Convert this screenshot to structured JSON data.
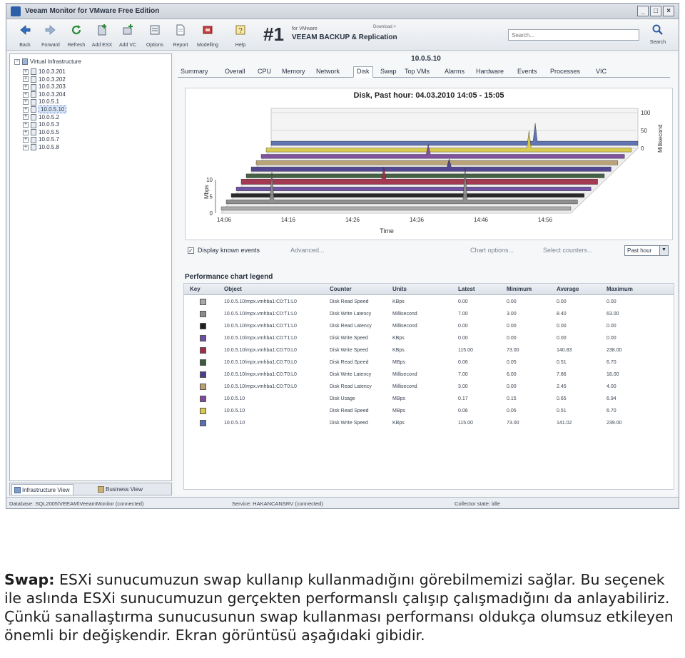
{
  "window": {
    "title": "Veeam Monitor for VMware Free Edition",
    "controls": [
      "_",
      "□",
      "×"
    ]
  },
  "toolbar": {
    "buttons": [
      {
        "label": "Back",
        "icon": "back-arrow-icon"
      },
      {
        "label": "Forward",
        "icon": "forward-arrow-icon"
      },
      {
        "label": "Refresh",
        "icon": "refresh-icon"
      },
      {
        "label": "Add ESX",
        "icon": "add-server-icon"
      },
      {
        "label": "Add VC",
        "icon": "add-vcenter-icon"
      },
      {
        "label": "Options",
        "icon": "options-icon"
      },
      {
        "label": "Report",
        "icon": "report-icon"
      },
      {
        "label": "Modelling",
        "icon": "modelling-icon"
      },
      {
        "label": "Help",
        "icon": "help-icon"
      }
    ],
    "banner": {
      "number": "#1",
      "small": "for VMware",
      "brand": "VEEAM BACKUP & Replication",
      "download": "Download >"
    },
    "search_placeholder": "Search...",
    "search_button_label": "Search"
  },
  "sidebar": {
    "root": "Virtual Infrastructure",
    "hosts": [
      "10.0.3.201",
      "10.0.3.202",
      "10.0.3.203",
      "10.0.3.204",
      "10.0.5.1",
      "10.0.5.10",
      "10.0.5.2",
      "10.0.5.3",
      "10.0.5.5",
      "10.0.5.7",
      "10.0.5.8"
    ],
    "selected": "10.0.5.10",
    "tabs": [
      "Infrastructure View",
      "Business View"
    ]
  },
  "main": {
    "host_title": "10.0.5.10",
    "tabs": [
      "Summary",
      "Overall",
      "CPU",
      "Memory",
      "Network",
      "Disk",
      "Swap",
      "Top VMs",
      "Alarms",
      "Hardware",
      "Events",
      "Processes",
      "VIC"
    ],
    "active_tab": "Disk",
    "options": {
      "display_known_events": "Display known events",
      "advanced": "Advanced...",
      "chart_options": "Chart options...",
      "select_counters": "Select counters...",
      "range": "Past hour"
    },
    "legend_title": "Performance chart legend",
    "legend_columns": [
      "Key",
      "Object",
      "Counter",
      "Units",
      "Latest",
      "Minimum",
      "Average",
      "Maximum"
    ],
    "legend_rows": [
      {
        "color": "#a9a9a9",
        "object": "10.0.5.10/mpx.vmhba1:C0:T1:L0",
        "counter": "Disk Read Speed",
        "units": "KBps",
        "latest": "0.00",
        "minimum": "0.00",
        "average": "0.00",
        "maximum": "0.00"
      },
      {
        "color": "#8b8b8b",
        "object": "10.0.5.10/mpx.vmhba1:C0:T1:L0",
        "counter": "Disk Write Latency",
        "units": "Millisecond",
        "latest": "7.00",
        "minimum": "3.00",
        "average": "8.40",
        "maximum": "63.00"
      },
      {
        "color": "#1f1f1f",
        "object": "10.0.5.10/mpx.vmhba1:C0:T1:L0",
        "counter": "Disk Read Latency",
        "units": "Millisecond",
        "latest": "0.00",
        "minimum": "0.00",
        "average": "0.00",
        "maximum": "0.00"
      },
      {
        "color": "#6b4fa0",
        "object": "10.0.5.10/mpx.vmhba1:C0:T1:L0",
        "counter": "Disk Write Speed",
        "units": "KBps",
        "latest": "0.00",
        "minimum": "0.00",
        "average": "0.00",
        "maximum": "0.00"
      },
      {
        "color": "#a0304a",
        "object": "10.0.5.10/mpx.vmhba1:C0:T0:L0",
        "counter": "Disk Write Speed",
        "units": "KBps",
        "latest": "115.00",
        "minimum": "73.00",
        "average": "140.83",
        "maximum": "238.00"
      },
      {
        "color": "#3c5a3c",
        "object": "10.0.5.10/mpx.vmhba1:C0:T0:L0",
        "counter": "Disk Read Speed",
        "units": "MBps",
        "latest": "0.06",
        "minimum": "0.05",
        "average": "0.51",
        "maximum": "6.70"
      },
      {
        "color": "#4a3f8c",
        "object": "10.0.5.10/mpx.vmhba1:C0:T0:L0",
        "counter": "Disk Write Latency",
        "units": "Millisecond",
        "latest": "7.00",
        "minimum": "6.00",
        "average": "7.86",
        "maximum": "18.00"
      },
      {
        "color": "#b8a070",
        "object": "10.0.5.10/mpx.vmhba1:C0:T0:L0",
        "counter": "Disk Read Latency",
        "units": "Millisecond",
        "latest": "3.00",
        "minimum": "0.00",
        "average": "2.45",
        "maximum": "4.00"
      },
      {
        "color": "#7d4a9c",
        "object": "10.0.5.10",
        "counter": "Disk Usage",
        "units": "MBps",
        "latest": "0.17",
        "minimum": "0.15",
        "average": "0.65",
        "maximum": "6.94"
      },
      {
        "color": "#d8c94a",
        "object": "10.0.5.10",
        "counter": "Disk Read Speed",
        "units": "MBps",
        "latest": "0.06",
        "minimum": "0.05",
        "average": "0.51",
        "maximum": "6.70"
      },
      {
        "color": "#5a6fb0",
        "object": "10.0.5.10",
        "counter": "Disk Write Speed",
        "units": "KBps",
        "latest": "115.00",
        "minimum": "73.00",
        "average": "141.02",
        "maximum": "239.00"
      }
    ]
  },
  "chart_data": {
    "type": "area",
    "title": "Disk, Past hour: 04.03.2010 14:05 - 15:05",
    "xlabel": "Time",
    "ylabel_left": "Mbps",
    "ylabel_right": "Millisecond",
    "x_ticks": [
      "14:06",
      "14:16",
      "14:26",
      "14:36",
      "14:46",
      "14:56"
    ],
    "y_ticks_left": [
      "0",
      "5",
      "10"
    ],
    "y_ticks_right": [
      "0",
      "50",
      "100"
    ],
    "ylim_left": [
      0,
      10
    ],
    "ylim_right": [
      0,
      100
    ],
    "render": "3d-stacked-bands",
    "series": [
      {
        "color": "#5a6fb0",
        "level": 0.25,
        "spikes": [
          {
            "t": 0.72,
            "h": 0.9
          }
        ]
      },
      {
        "color": "#d8c94a",
        "level": 0.2,
        "spikes": [
          {
            "t": 0.72,
            "h": 0.85
          }
        ]
      },
      {
        "color": "#7d4a9c",
        "level": 0.22,
        "spikes": [
          {
            "t": 0.46,
            "h": 0.5
          }
        ]
      },
      {
        "color": "#b8a070",
        "level": 0.25,
        "spikes": []
      },
      {
        "color": "#4a3f8c",
        "level": 0.3,
        "spikes": [
          {
            "t": 0.55,
            "h": 0.4
          }
        ]
      },
      {
        "color": "#3c5a3c",
        "level": 0.2,
        "spikes": []
      },
      {
        "color": "#a0304a",
        "level": 0.45,
        "spikes": [
          {
            "t": 0.4,
            "h": 0.6
          }
        ]
      },
      {
        "color": "#6b4fa0",
        "level": 0.18,
        "spikes": []
      },
      {
        "color": "#1f1f1f",
        "level": 0.15,
        "spikes": []
      },
      {
        "color": "#8b8b8b",
        "level": 0.2,
        "spikes": [
          {
            "t": 0.68,
            "h": 1.6
          },
          {
            "t": 0.13,
            "h": 1.4
          }
        ]
      },
      {
        "color": "#a9a9a9",
        "level": 0.12,
        "spikes": []
      }
    ]
  },
  "statusbar": {
    "database": "Database: SQL2005\\VEEAM\\VeeamMonitor (connected)",
    "service": "Service: HAKANCANSRV (connected)",
    "collector": "Collector state: idle"
  },
  "caption": {
    "keyword": "Swap:",
    "text": " ESXi sunucumuzun swap kullanıp kullanmadığını görebilmemizi sağlar. Bu seçenek ile aslında ESXi sunucumuzun gerçekten performanslı çalışıp çalışmadığını da anlayabiliriz. Çünkü sanallaştırma sunucusunun swap kullanması performansı oldukça olumsuz etkileyen önemli bir değişkendir. Ekran görüntüsü aşağıdaki gibidir."
  }
}
